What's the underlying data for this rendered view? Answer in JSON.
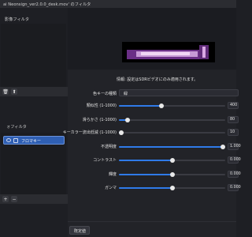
{
  "window": {
    "title": "ai Neonsign_ver2.0.0_desk.mov' のフィルタ"
  },
  "left": {
    "effect_filters_label": "影像フィルタ",
    "audio_filters_label": "ォフィルタ",
    "selected_filter": "フロマキー",
    "toolbar_icons": [
      "trash-icon",
      "up-arrow-icon"
    ]
  },
  "info": "情報: 設定はSDRビデオにのみ適用されます。",
  "properties": {
    "key_color_type_label": "色キーの種類",
    "key_color_type_value": "緑",
    "sliders": [
      {
        "label": "類似性 (1-1000)",
        "value": "400",
        "fraction": 0.4
      },
      {
        "label": "滑らかさ (1-1000)",
        "value": "80",
        "fraction": 0.08
      },
      {
        "label": "キーカラー流出低減 (1-1000)",
        "value": "10",
        "fraction": 0.01
      },
      {
        "label": "不透明度",
        "value": "1.000",
        "fraction": 1.0
      },
      {
        "label": "コントラスト",
        "value": "0.000",
        "fraction": 0.5
      },
      {
        "label": "輝度",
        "value": "0.000",
        "fraction": 0.5
      },
      {
        "label": "ガンマ",
        "value": "0.000",
        "fraction": 0.5
      }
    ]
  },
  "buttons": {
    "defaults": "既定値"
  },
  "colors": {
    "accent": "#2f7ae8",
    "selection": "#2f5fb3"
  }
}
